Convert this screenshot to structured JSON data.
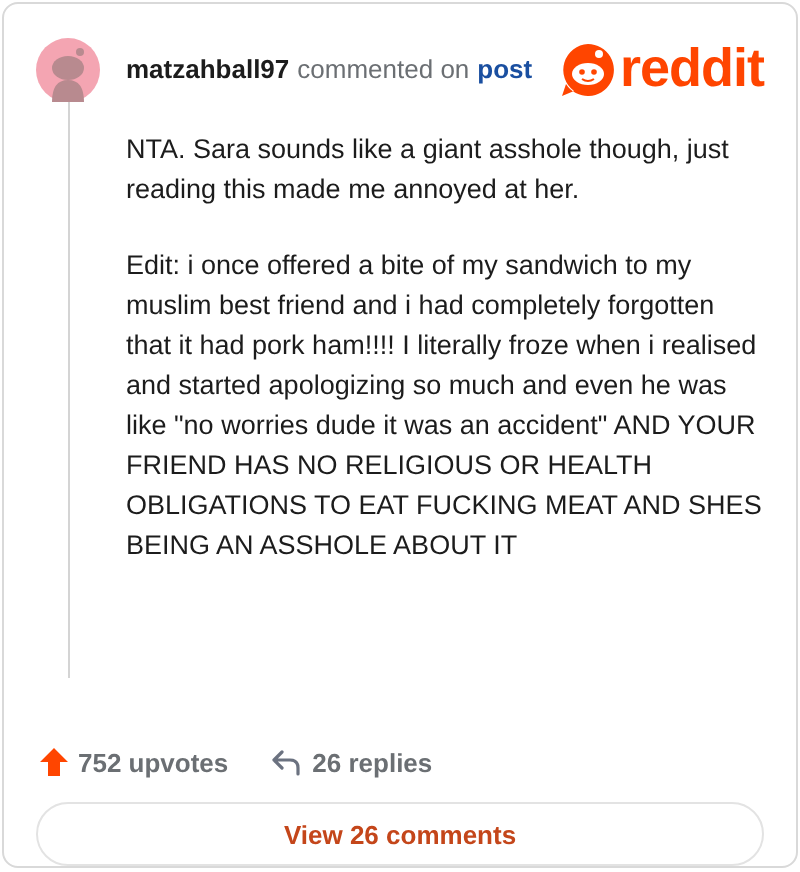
{
  "comment": {
    "author": "matzahball97",
    "action": "commented on",
    "target": "post",
    "paragraphs": [
      "NTA. Sara sounds like a giant asshole though, just reading this made me annoyed at her.",
      "Edit: i once offered a bite of my sandwich to my muslim best friend and i had completely forgotten that it had pork ham!!!! I literally froze when i realised and started apologizing so much and even he was like \"no worries dude it was an accident\" AND YOUR FRIEND HAS NO RELIGIOUS OR HEALTH OBLIGATIONS TO EAT FUCKING MEAT AND SHES BEING AN ASSHOLE ABOUT IT"
    ],
    "upvotes": "752 upvotes",
    "replies": "26 replies"
  },
  "logo": {
    "text": "reddit"
  },
  "button": {
    "label": "View 26 comments"
  }
}
